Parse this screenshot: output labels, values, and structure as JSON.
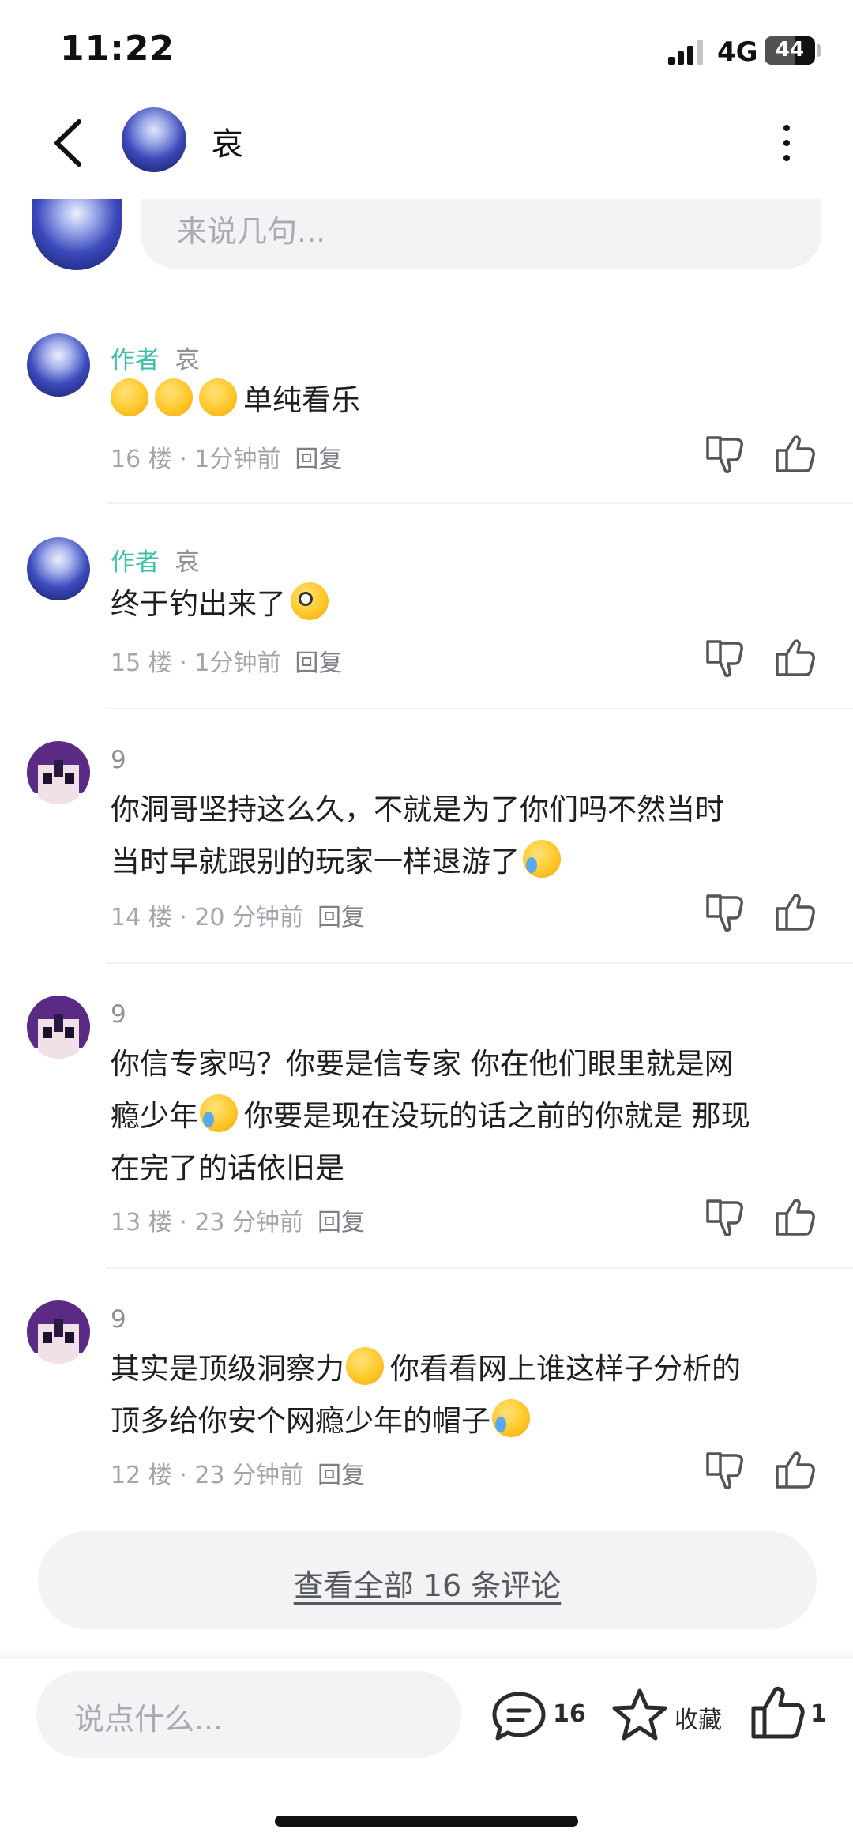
{
  "status_bar": {
    "time": "11:22",
    "network": "4G",
    "battery": "44"
  },
  "header": {
    "title": "哀"
  },
  "composer": {
    "placeholder": "来说几句..."
  },
  "comments": [
    {
      "author_tag": "作者",
      "name": "哀",
      "text": "单纯看乐",
      "floor": "16 楼",
      "time": "1分钟前",
      "reply": "回复"
    },
    {
      "author_tag": "作者",
      "name": "哀",
      "text": "终于钓出来了",
      "floor": "15 楼",
      "time": "1分钟前",
      "reply": "回复"
    },
    {
      "name": "9",
      "text_a": "你洞哥坚持这么久，不就是为了你们吗不然当时",
      "text_b": "当时早就跟别的玩家一样退游了",
      "floor": "14 楼",
      "time": "20 分钟前",
      "reply": "回复"
    },
    {
      "name": "9",
      "text_a": "你信专家吗？你要是信专家 你在他们眼里就是网",
      "text_b": "瘾少年",
      "text_c": "你要是现在没玩的话之前的你就是 那现",
      "text_d": "在完了的话依旧是",
      "floor": "13 楼",
      "time": "23 分钟前",
      "reply": "回复"
    },
    {
      "name": "9",
      "text_a": "其实是顶级洞察力",
      "text_b": "你看看网上谁这样子分析的",
      "text_c": "顶多给你安个网瘾少年的帽子",
      "floor": "12 楼",
      "time": "23 分钟前",
      "reply": "回复"
    }
  ],
  "view_all": {
    "label": "查看全部 16 条评论"
  },
  "bottom_bar": {
    "placeholder": "说点什么...",
    "comment_count": "16",
    "collect_label": "收藏",
    "like_count": "1"
  },
  "icons": {
    "back": "back-arrow-icon",
    "more": "more-vertical-icon",
    "dislike": "thumbs-down-icon",
    "like": "thumbs-up-icon",
    "comment": "comment-bubble-icon",
    "collect": "star-icon",
    "thumb": "thumbs-up-icon"
  },
  "colors": {
    "author_tag": "#3cc0a8",
    "muted": "#a2a5ab",
    "input_bg": "#f2f3f5"
  }
}
